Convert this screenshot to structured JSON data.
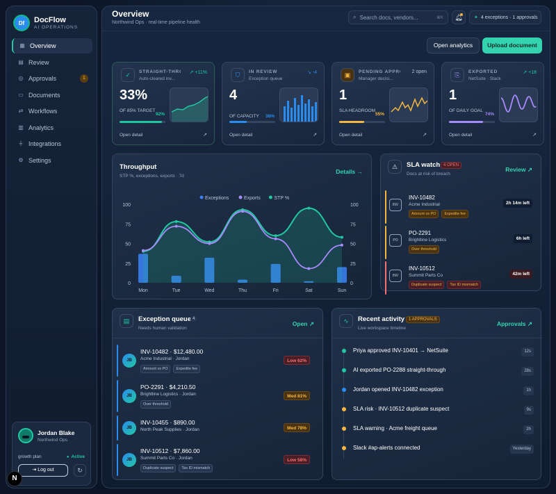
{
  "brand": {
    "logo": "Df",
    "name": "DocFlow",
    "sub": "AI OPERATIONS"
  },
  "nav": [
    {
      "label": "Overview",
      "icon": "grid-icon"
    },
    {
      "label": "Review",
      "icon": "document-icon"
    },
    {
      "label": "Approvals",
      "icon": "check-circle-icon",
      "badge": "1"
    },
    {
      "label": "Documents",
      "icon": "folder-icon"
    },
    {
      "label": "Workflows",
      "icon": "workflow-icon"
    },
    {
      "label": "Analytics",
      "icon": "chart-icon"
    },
    {
      "label": "Integrations",
      "icon": "plug-icon"
    },
    {
      "label": "Settings",
      "icon": "gear-icon"
    }
  ],
  "profile": {
    "name": "Jordan Blake",
    "org": "Northwind Ops",
    "plan": "growth plan",
    "status": "Active",
    "logout": "Log out"
  },
  "n_badge": "N",
  "header": {
    "title": "Overview",
    "subtitle": "Northwind Ops · real-time pipeline health",
    "search_placeholder": "Search docs, vendors...",
    "search_kbd": "⌘K",
    "status_pill": "4 exceptions · 1 approvals",
    "btn_analytics": "Open analytics",
    "btn_upload": "Upload document"
  },
  "kpis": [
    {
      "title": "STRAIGHT-THROUGH",
      "sub": "Auto-cleared inv...",
      "delta": "↗ +11%",
      "value": "33%",
      "caption": "OF 85% TARGET",
      "pct": "92%",
      "progress": 0.92,
      "link": "Open detail",
      "color": "#22c7a1",
      "icon": "check-icon"
    },
    {
      "title": "IN REVIEW",
      "sub": "Exception queue",
      "delta": "↘ -4",
      "value": "4",
      "caption": "OF CAPACITY",
      "pct": "38%",
      "progress": 0.38,
      "link": "Open detail",
      "color": "#2b8cf0",
      "icon": "shield-icon"
    },
    {
      "title": "PENDING APPROVALS",
      "sub": "Manager decisi...",
      "delta": "2 open",
      "value": "1",
      "caption": "SLA HEADROOM",
      "pct": "55%",
      "progress": 0.55,
      "link": "Open detail",
      "color": "#f5b642",
      "icon": "clipboard-icon"
    },
    {
      "title": "EXPORTED",
      "sub": "NetSuite · Slack",
      "delta": "↗ +18",
      "value": "1",
      "caption": "OF DAILY GOAL",
      "pct": "74%",
      "progress": 0.74,
      "link": "Open detail",
      "color": "#a78bfa",
      "icon": "export-icon"
    }
  ],
  "throughput": {
    "title": "Throughput",
    "sub": "STP %, exceptions, exports · 7d",
    "link": "Details →"
  },
  "chart_data": {
    "type": "line",
    "title": "Throughput",
    "categories": [
      "Mon",
      "Tue",
      "Wed",
      "Thu",
      "Fri",
      "Sat",
      "Sun"
    ],
    "ylim": [
      0,
      100
    ],
    "yticks": [
      "100",
      "75",
      "50",
      "25",
      "0"
    ],
    "legend": "top",
    "series": [
      {
        "name": "Exceptions",
        "kind": "bar",
        "color": "#3b82f6",
        "values": [
          37,
          9,
          32,
          4,
          24,
          2,
          20
        ]
      },
      {
        "name": "Exports",
        "kind": "line",
        "color": "#a78bfa",
        "values": [
          41,
          72,
          50,
          91,
          56,
          18,
          48
        ]
      },
      {
        "name": "STP %",
        "kind": "area",
        "color": "#22c7a1",
        "values": [
          40,
          78,
          52,
          93,
          60,
          95,
          58
        ]
      }
    ]
  },
  "sla": {
    "title": "SLA watch",
    "badge": "4 OPEN",
    "sub": "Docs at risk of breach",
    "link": "Review ↗",
    "items": [
      {
        "id": "INV-10482",
        "company": "Acme Industrial",
        "tags": [
          "Amount vs PO",
          "Expedite fee"
        ],
        "time": "2h 14m left",
        "doc": "INV",
        "color": "#f5b642"
      },
      {
        "id": "PO-2291",
        "company": "Brightline Logistics",
        "tags": [
          "Over threshold"
        ],
        "time": "6h left",
        "doc": "PO",
        "color": "#f5b642"
      },
      {
        "id": "INV-10512",
        "company": "Summit Parts Co",
        "tags": [
          "Duplicate suspect",
          "Tax ID mismatch"
        ],
        "time": "42m left",
        "doc": "INV",
        "color": "#f87171"
      }
    ]
  },
  "exceptions": {
    "title": "Exception queue",
    "count": "4",
    "sub": "Needs human validation",
    "link": "Open ↗",
    "items": [
      {
        "id": "INV-10482 · $12,480.00",
        "company": "Acme Industrial · Jordan",
        "tags": [
          "Amount vs PO",
          "Expedite fee"
        ],
        "risk": "Low 62%",
        "level": "low",
        "initials": "JB"
      },
      {
        "id": "PO-2291 · $4,210.50",
        "company": "Brightline Logistics · Jordan",
        "tags": [
          "Over threshold"
        ],
        "risk": "Med 81%",
        "level": "med",
        "initials": "JB"
      },
      {
        "id": "INV-10455 · $890.00",
        "company": "North Peak Supplies · Jordan",
        "tags": [],
        "risk": "Med 78%",
        "level": "med",
        "initials": "JB"
      },
      {
        "id": "INV-10512 · $7,860.00",
        "company": "Summit Parts Co · Jordan",
        "tags": [
          "Duplicate suspect",
          "Tax ID mismatch"
        ],
        "risk": "Low 58%",
        "level": "low",
        "initials": "JB"
      }
    ]
  },
  "activity": {
    "title": "Recent activity",
    "badge": "1 APPROVALS",
    "sub": "Live workspace timeline",
    "link": "Approvals ↗",
    "items": [
      {
        "text": "Priya approved INV-10401 → NetSuite",
        "time": "12s",
        "color": "#22c7a1"
      },
      {
        "text": "AI exported PO-2288 straight-through",
        "time": "28s",
        "color": "#22c7a1"
      },
      {
        "text": "Jordan opened INV-10482 exception",
        "time": "1h",
        "color": "#2b8cf0"
      },
      {
        "text": "SLA risk · INV-10512 duplicate suspect",
        "time": "9s",
        "color": "#f5b642"
      },
      {
        "text": "SLA warning · Acme freight queue",
        "time": "2h",
        "color": "#f5b642"
      },
      {
        "text": "Slack #ap-alerts connected",
        "time": "Yesterday",
        "color": "#f5b642"
      }
    ]
  }
}
